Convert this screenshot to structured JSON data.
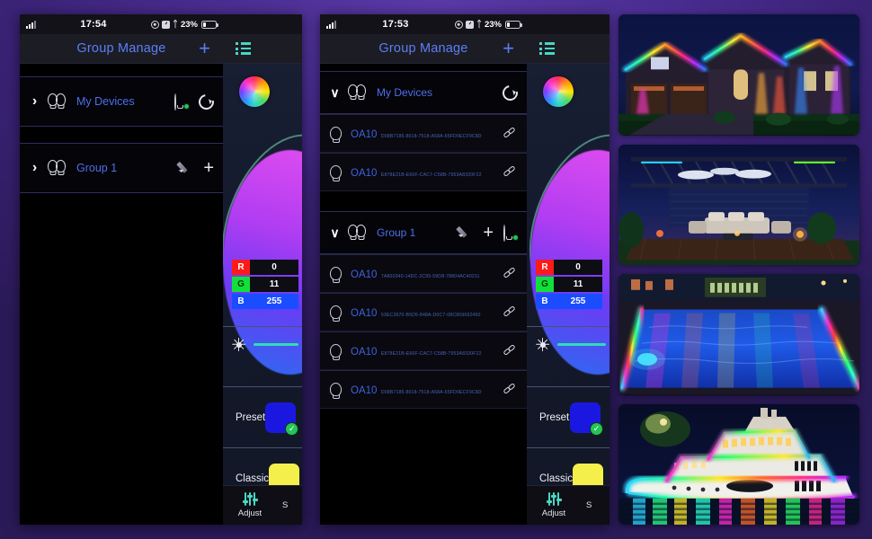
{
  "app": {
    "title": "Group Manage",
    "add_label": "+",
    "menu_icon": "list-menu-icon"
  },
  "phone1": {
    "status": {
      "time": "17:54",
      "battery": "23%",
      "signal": "signal-icon",
      "location_icon": "location-icon",
      "alarm_icon": "alarm-icon",
      "bluetooth_icon": "bluetooth-icon"
    },
    "groups": [
      {
        "chevron": "›",
        "label": "My Devices",
        "expanded": false,
        "actions": [
          "bulb-power-icon",
          "refresh-icon"
        ]
      },
      {
        "chevron": "›",
        "label": "Group 1",
        "expanded": false,
        "actions": [
          "pencil-icon",
          "plus-icon"
        ]
      }
    ]
  },
  "phone2": {
    "status": {
      "time": "17:53",
      "battery": "23%"
    },
    "group_my_devices": {
      "chevron": "∨",
      "label": "My Devices",
      "expanded": true
    },
    "group_1": {
      "chevron": "∨",
      "label": "Group 1",
      "expanded": true
    },
    "my_devices": [
      {
        "name": "OA10",
        "uuid": "D08B7185-8018-7518-A58A-65FD0ECF9C8D",
        "link": "link-icon"
      },
      {
        "name": "OA10",
        "uuid": "E878E21B-E66F-CAC7-C58B-7953A8320F22",
        "link": "link-icon"
      }
    ],
    "group1_devices": [
      {
        "name": "OA10",
        "uuid": "7A800340-14DC-2C95-59D8-78804AC40211",
        "link": "link-icon"
      },
      {
        "name": "OA10",
        "uuid": "53EC3970-B5D5-848A-D0C7-08C859692450",
        "link": "link-icon"
      },
      {
        "name": "OA10",
        "uuid": "E878E21B-E66F-CAC7-C58B-7953A8320F22",
        "link": "link-icon"
      },
      {
        "name": "OA10",
        "uuid": "D08B7185-8018-7518-A58A-65FD0ECF9C8D",
        "link": "link-icon"
      }
    ]
  },
  "control": {
    "color_wheel": "color-wheel-icon",
    "rgb": {
      "r_key": "R",
      "r_value": "0",
      "g_key": "G",
      "g_value": "11",
      "b_key": "B",
      "b_value": "255"
    },
    "brightness_icon": "brightness-icon",
    "preset": {
      "label": "Preset",
      "color": "#1a18e0",
      "selected": true
    },
    "classic": {
      "label": "Classic",
      "color": "#f5ef4b",
      "selected": false
    },
    "tabs": [
      {
        "label": "Adjust",
        "icon": "sliders-icon",
        "active": true
      },
      {
        "label": "S",
        "icon": "",
        "active": false
      }
    ]
  },
  "photos": [
    {
      "name": "house-rgb-lighting"
    },
    {
      "name": "pergola-patio-rgb-lighting"
    },
    {
      "name": "swimming-pool-rgb-lighting"
    },
    {
      "name": "yacht-rgb-lighting"
    }
  ],
  "colors": {
    "accent_blue": "#4f6fe8",
    "teal": "#49d6c4",
    "green": "#25c455",
    "background_purple": "#4a2d91"
  }
}
